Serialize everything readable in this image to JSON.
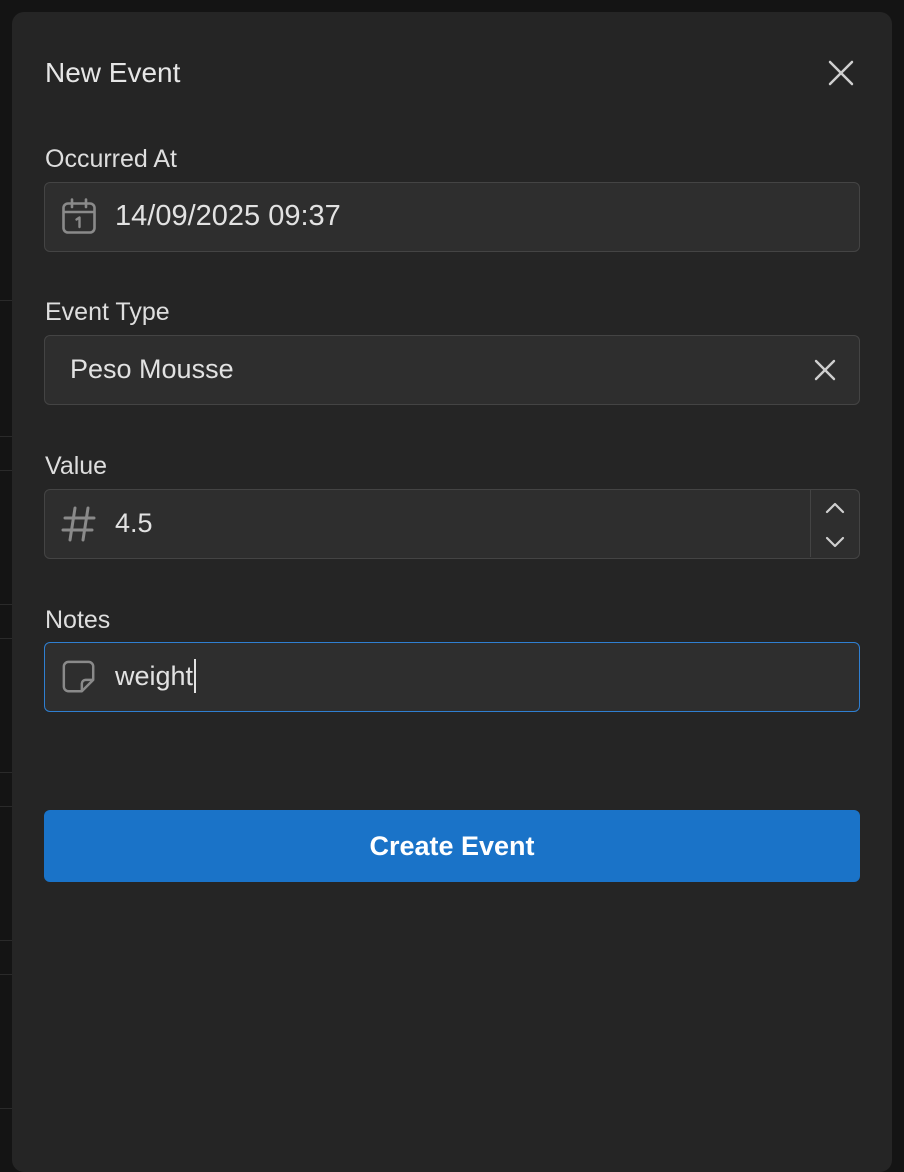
{
  "modal": {
    "title": "New Event",
    "close_icon": "close-icon"
  },
  "fields": {
    "occurred_at": {
      "label": "Occurred At",
      "value": "14/09/2025 09:37",
      "icon": "calendar-icon"
    },
    "event_type": {
      "label": "Event Type",
      "value": "Peso Mousse",
      "clear_icon": "clear-icon"
    },
    "value": {
      "label": "Value",
      "value": "4.5",
      "icon": "hash-icon",
      "increment_icon": "chevron-up-icon",
      "decrement_icon": "chevron-down-icon"
    },
    "notes": {
      "label": "Notes",
      "value": "weight",
      "icon": "note-icon"
    }
  },
  "actions": {
    "submit_label": "Create Event"
  },
  "colors": {
    "accent": "#1a73c8",
    "focus_border": "#2f7fd1",
    "modal_background": "#252525",
    "input_background": "#2e2e2e"
  }
}
